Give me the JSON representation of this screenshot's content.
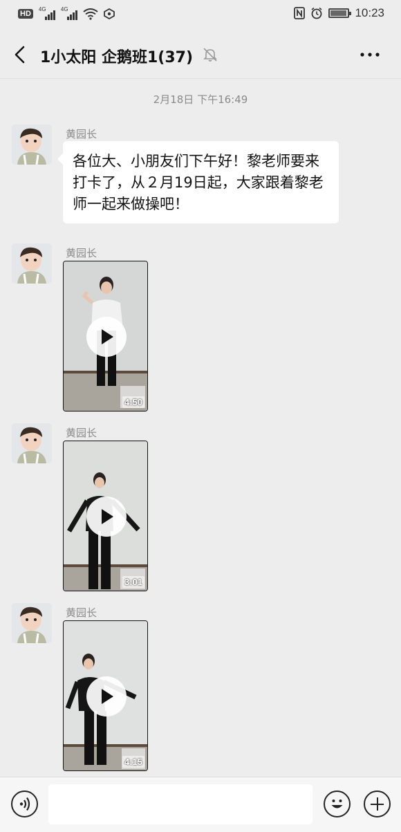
{
  "status_bar": {
    "hd_label": "HD",
    "signal1_label": "4G",
    "signal2_label": "4G",
    "time": "10:23",
    "icons": [
      "hd-icon",
      "signal-icon",
      "wifi-icon",
      "nfc-icon",
      "alarm-icon",
      "battery-icon"
    ]
  },
  "header": {
    "title": "1小太阳 企鹅班1(37)",
    "icons": [
      "back-arrow-icon",
      "bell-muted-icon",
      "more-icon"
    ]
  },
  "chat": {
    "timestamp": "2月18日 下午16:49",
    "messages": [
      {
        "sender": "黄园长",
        "type": "text",
        "text": "各位大、小朋友们下午好！黎老师要来打卡了，从２月19日起，大家跟着黎老师一起来做操吧！"
      },
      {
        "sender": "黄园长",
        "type": "video",
        "duration": "4:50"
      },
      {
        "sender": "黄园长",
        "type": "video",
        "duration": "3:01"
      },
      {
        "sender": "黄园长",
        "type": "video",
        "duration": "4:15"
      }
    ]
  },
  "input_bar": {
    "placeholder": "",
    "icons": [
      "voice-icon",
      "emoji-icon",
      "plus-icon"
    ]
  },
  "colors": {
    "background": "#ededed",
    "bubble": "#ffffff",
    "meta_text": "#8a8a8a"
  }
}
